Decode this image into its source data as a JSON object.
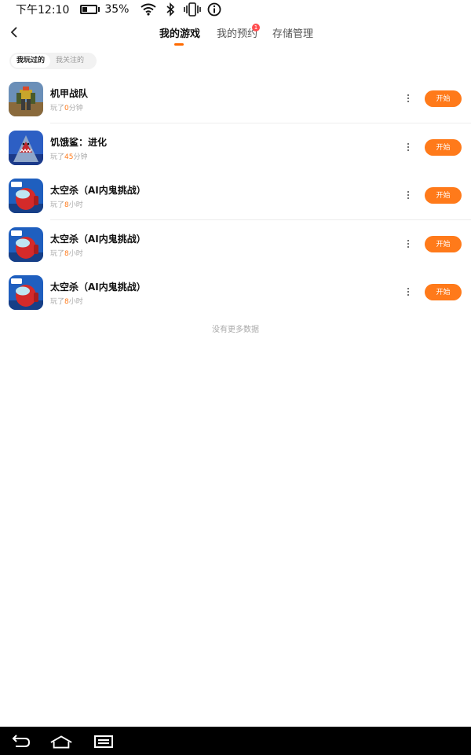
{
  "status_bar": {
    "time": "下午12:10",
    "battery_percent": "35%",
    "battery_level": 0.35,
    "icons": [
      "battery-icon",
      "wifi-icon",
      "bluetooth-icon",
      "vibrate-icon",
      "info-icon"
    ]
  },
  "header": {
    "back_icon": "chevron-left-icon",
    "tabs": [
      {
        "label": "我的游戏",
        "active": true
      },
      {
        "label": "我的预约",
        "active": false,
        "badge": "1"
      },
      {
        "label": "存储管理",
        "active": false
      }
    ]
  },
  "filter": {
    "options": [
      {
        "label": "我玩过的",
        "active": true
      },
      {
        "label": "我关注的",
        "active": false
      }
    ]
  },
  "games": [
    {
      "name": "机甲战队",
      "play_prefix": "玩了",
      "play_value": "0",
      "play_unit": "分钟",
      "button": "开始",
      "icon": "mech-robot-game-icon"
    },
    {
      "name": "饥饿鲨：进化",
      "play_prefix": "玩了",
      "play_value": "45",
      "play_unit": "分钟",
      "button": "开始",
      "icon": "shark-game-icon"
    },
    {
      "name": "太空杀（AI内鬼挑战）",
      "play_prefix": "玩了",
      "play_value": "8",
      "play_unit": "小时",
      "button": "开始",
      "icon": "crewmate-game-icon"
    },
    {
      "name": "太空杀（AI内鬼挑战）",
      "play_prefix": "玩了",
      "play_value": "8",
      "play_unit": "小时",
      "button": "开始",
      "icon": "crewmate-game-icon"
    },
    {
      "name": "太空杀（AI内鬼挑战）",
      "play_prefix": "玩了",
      "play_value": "8",
      "play_unit": "小时",
      "button": "开始",
      "icon": "crewmate-game-icon"
    }
  ],
  "no_more_text": "没有更多数据",
  "nav_bar": {
    "icons": [
      "back-arrow-icon",
      "home-icon",
      "recent-apps-icon"
    ]
  },
  "colors": {
    "accent": "#ff7a1a",
    "badge": "#ff4d4f",
    "divider": "#ededed"
  }
}
